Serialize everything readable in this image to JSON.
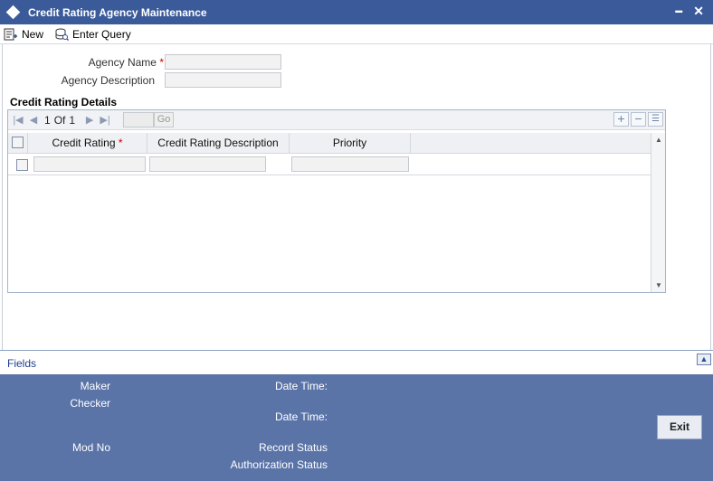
{
  "window": {
    "title": "Credit Rating Agency Maintenance",
    "minimize_glyph": "▬",
    "close_glyph": "✕"
  },
  "toolbar": {
    "new_label": "New",
    "enter_query_label": "Enter Query"
  },
  "form": {
    "agency_name_label": "Agency Name",
    "agency_name_value": "",
    "agency_description_label": "Agency Description",
    "agency_description_value": "",
    "required_marker": "*"
  },
  "details": {
    "section_title": "Credit Rating Details",
    "pager": {
      "current": "1",
      "of_label": "Of",
      "total": "1",
      "go_label": "Go",
      "page_input_value": ""
    },
    "columns": [
      "Credit Rating",
      "Credit Rating Description",
      "Priority"
    ],
    "rows": [
      {
        "credit_rating": "",
        "description": "",
        "priority": ""
      }
    ]
  },
  "fields_bar": {
    "label": "Fields"
  },
  "footer": {
    "maker_label": "Maker",
    "checker_label": "Checker",
    "date_time_label_1": "Date Time:",
    "date_time_label_2": "Date Time:",
    "mod_no_label": "Mod No",
    "record_status_label": "Record Status",
    "authorization_status_label": "Authorization Status",
    "exit_label": "Exit"
  },
  "colors": {
    "titlebar": "#3a5a99",
    "footer": "#5a74a8",
    "required": "#cc0000"
  }
}
